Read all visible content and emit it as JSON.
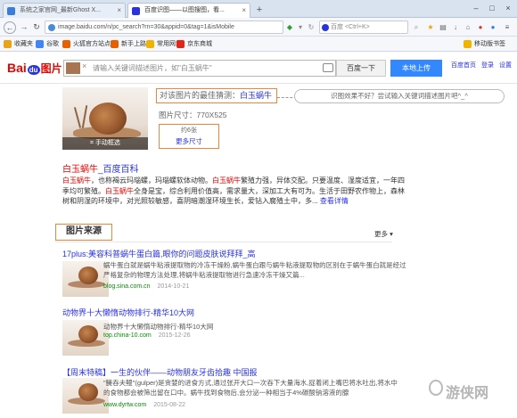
{
  "tabs": [
    {
      "title": "系统之家官网_最新Ghost X...",
      "active": false
    },
    {
      "title": "百度识图——以图搜图，看...",
      "active": true
    }
  ],
  "nav": {
    "url": "image.baidu.com/n/pc_search?rn=30&appid=0&tag=1&isMobile",
    "search_placeholder": "百度 <Ctrl+K>"
  },
  "bookmarks": [
    {
      "label": "收藏夹",
      "color": "#e8a317"
    },
    {
      "label": "谷歌",
      "color": "#4285f4"
    },
    {
      "label": "火狐官方站点",
      "color": "#e66000"
    },
    {
      "label": "新手上路",
      "color": "#e66000"
    },
    {
      "label": "常用网址",
      "color": "#f0b400"
    },
    {
      "label": "京东商城",
      "color": "#e1251b"
    }
  ],
  "bookmarks_right": "移动版书签",
  "baidu": {
    "logo_bai": "Bai",
    "logo_du": "du",
    "logo_pic": "图片",
    "search_placeholder": "请输入关键词描述图片，如\"白玉蜗牛\"",
    "search_button": "百度一下",
    "upload_button": "本地上传",
    "top_links": [
      "百度首页",
      "登录",
      "设置"
    ]
  },
  "guess": {
    "prefix": "对该图片的最佳猜测：",
    "keyword": "白玉蜗牛"
  },
  "feedback_text": "识图效果不好？尝试输入关键词描述图片吧^_^",
  "main_image": {
    "caption": "手动框选",
    "size_label": "图片尺寸：770X525",
    "count_label": "约6张",
    "more_sizes": "更多尺寸"
  },
  "baike": {
    "title_hl": "白玉蜗牛",
    "title_rest": "_百度百科",
    "body_hl1": "白玉蜗牛",
    "body_1": "，也称褐云玛瑙螺，玛瑙螺软体动物。",
    "body_hl2": "白玉蜗牛",
    "body_2": "繁殖力强，异体交配。只要温度、湿度适宜，一年四季均可繁殖。",
    "body_hl3": "白玉蜗牛",
    "body_3": "全身是宝，综合利用价值高，需求量大，深加工大有可为。生活于田野农作物上，森林树和阴湿的环境中，对光照较敏感，喜阴暗潮湿环境生长，爱钻入腐殖土中，多...",
    "more": "查看详情"
  },
  "source": {
    "heading": "图片来源",
    "more": "更多"
  },
  "results": [
    {
      "title": "17plus:美容科普蜗牛蛋白篇,眼你的问题皮肤说拜拜_高",
      "desc": "蜗牛蛋白就是蜗牛粘液提取物的冷冻干燥粉,蜗牛蛋白跟与蜗牛粘液提取物的区别在于蜗牛蛋白就是经过严格复杂的物理方法处理,将蜗牛粘液提取物进行急速冷冻干燥又篇...",
      "site": "blog.sina.com.cn",
      "date": "2014-10-21"
    },
    {
      "title": "动物界十大懒惰动物排行-精华10大网",
      "desc": "动物界十大懒惰动物排行-精华10大网",
      "site": "top.china-10.com",
      "date": "2015-12-26"
    },
    {
      "title": "【周末特稿】一生的伙伴——动物朋友牙齿拾趣 中国报",
      "desc": "\"臃吞夫鳗\"(gulper)是贪婪的进食方式,通过张开大口一次吞下大量海水,捉着闭上嘴巴将水吐出,将水中的食物都会被筛出留在口中。蜗牛找到食物后,会分泌一种相当于4%碳酸钠溶液的腺",
      "site": "www.dyrtw.com",
      "date": "2015-08-22"
    }
  ],
  "watermark": "游侠网"
}
